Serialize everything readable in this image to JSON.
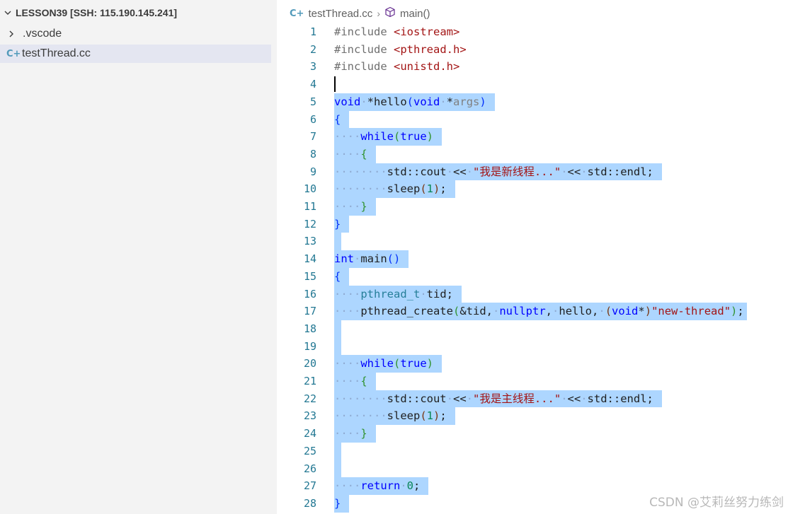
{
  "sidebar": {
    "folder_title": "LESSON39 [SSH: 115.190.145.241]",
    "items": [
      {
        "label": ".vscode",
        "type": "folder"
      },
      {
        "label": "testThread.cc",
        "type": "file",
        "icon_text": "C+"
      }
    ]
  },
  "breadcrumb": {
    "file_icon_text": "C+",
    "file": "testThread.cc",
    "separator": "›",
    "symbol": "main()"
  },
  "editor": {
    "line_numbers": [
      "1",
      "2",
      "3",
      "4",
      "5",
      "6",
      "7",
      "8",
      "9",
      "10",
      "11",
      "12",
      "13",
      "14",
      "15",
      "16",
      "17",
      "18",
      "19",
      "20",
      "21",
      "22",
      "23",
      "24",
      "25",
      "26",
      "27",
      "28"
    ]
  },
  "watermark": "CSDN @艾莉丝努力练剑",
  "colors": {
    "selection": "#add6ff",
    "keyword": "#0000ff",
    "string": "#a31515",
    "line_number": "#237893",
    "sidebar_bg": "#f3f3f3"
  }
}
